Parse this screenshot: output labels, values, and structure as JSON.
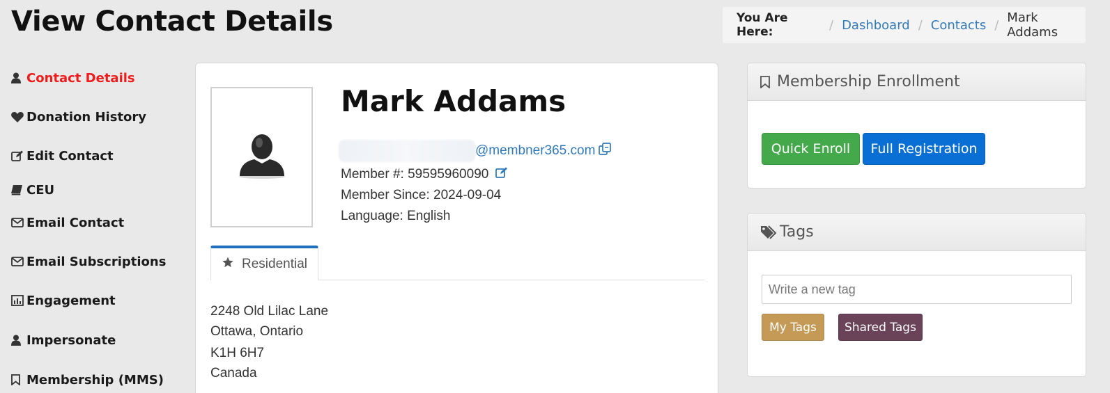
{
  "page": {
    "title": "View Contact Details"
  },
  "breadcrumb": {
    "label": "You Are Here:",
    "items": [
      "Dashboard",
      "Contacts"
    ],
    "current": "Mark Addams"
  },
  "sidenav": [
    {
      "label": "Contact Details",
      "icon": "user-icon",
      "active": true
    },
    {
      "label": "Donation History",
      "icon": "heart-icon"
    },
    {
      "label": "Edit Contact",
      "icon": "edit-icon"
    },
    {
      "label": "CEU",
      "icon": "book-icon"
    },
    {
      "label": "Email Contact",
      "icon": "envelope-icon"
    },
    {
      "label": "Email Subscriptions",
      "icon": "envelope-icon"
    },
    {
      "label": "Engagement",
      "icon": "bar-chart-icon"
    },
    {
      "label": "Impersonate",
      "icon": "user-icon"
    },
    {
      "label": "Membership (MMS)",
      "icon": "bookmark-icon"
    }
  ],
  "contact": {
    "name": "Mark Addams",
    "email_domain": "@membner365.com",
    "member_number": "Member #: 59595960090",
    "member_since": "Member Since: 2024-09-04",
    "language": "Language: English"
  },
  "address_tab": {
    "label": "Residential",
    "icon": "star-icon"
  },
  "address": {
    "line1": "2248 Old Lilac Lane",
    "line2": "Ottawa, Ontario",
    "line3": "K1H 6H7",
    "line4": "Canada"
  },
  "membership_panel": {
    "title": "Membership Enrollment",
    "quick_enroll": "Quick Enroll",
    "full_registration": "Full Registration"
  },
  "tags_panel": {
    "title": "Tags",
    "input_placeholder": "Write a new tag",
    "my_tags": "My Tags",
    "shared_tags": "Shared Tags"
  },
  "colors": {
    "active_nav": "#ef1c1c",
    "link": "#337ab7",
    "green": "#43a94a",
    "blue": "#0a6fd4",
    "my_tags": "#c49a56",
    "shared_tags": "#6a4358"
  }
}
